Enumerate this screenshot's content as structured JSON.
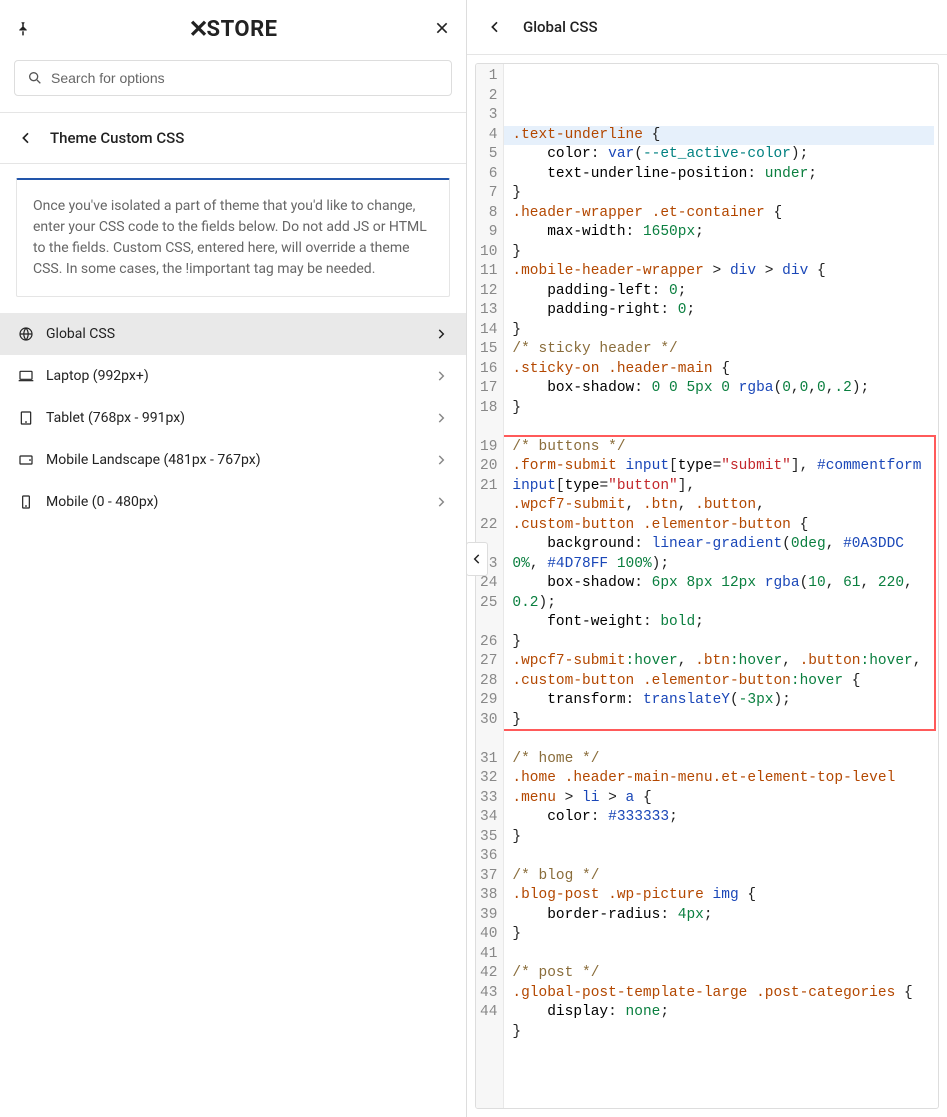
{
  "left": {
    "logo_text": "STORE",
    "search_placeholder": "Search for options",
    "section_title": "Theme Custom CSS",
    "info_text": "Once you've isolated a part of theme that you'd like to change, enter your CSS code to the fields below. Do not add JS or HTML to the fields. Custom CSS, entered here, will override a theme CSS. In some cases, the !important tag may be needed.",
    "menu": [
      {
        "label": "Global CSS",
        "active": true
      },
      {
        "label": "Laptop (992px+)",
        "active": false
      },
      {
        "label": "Tablet (768px - 991px)",
        "active": false
      },
      {
        "label": "Mobile Landscape (481px - 767px)",
        "active": false
      },
      {
        "label": "Mobile (0 - 480px)",
        "active": false
      }
    ]
  },
  "right": {
    "title": "Global CSS",
    "highlight": {
      "start": 17,
      "end": 27
    },
    "total_lines": 44,
    "code": [
      {
        "html": "<span class='c-sel'>.text-underline</span> {"
      },
      {
        "html": "    <span class='c-prop'>color</span>: <span class='c-kw'>var</span>(<span class='c-var'>--et_active-color</span>);"
      },
      {
        "html": "    <span class='c-prop'>text-underline-position</span>: <span class='c-num'>under</span>;"
      },
      {
        "html": "}"
      },
      {
        "html": "<span class='c-sel'>.header-wrapper</span> <span class='c-sel'>.et-container</span> {"
      },
      {
        "html": "    <span class='c-prop'>max-width</span>: <span class='c-num'>1650px</span>;"
      },
      {
        "html": "}"
      },
      {
        "html": "<span class='c-sel'>.mobile-header-wrapper</span> &gt; <span class='c-tag'>div</span> &gt; <span class='c-tag'>div</span> {"
      },
      {
        "html": "    <span class='c-prop'>padding-left</span>: <span class='c-num'>0</span>;"
      },
      {
        "html": "    <span class='c-prop'>padding-right</span>: <span class='c-num'>0</span>;"
      },
      {
        "html": "}"
      },
      {
        "html": "<span class='c-com'>/* sticky header */</span>"
      },
      {
        "html": "<span class='c-sel'>.sticky-on</span> <span class='c-sel'>.header-main</span> {"
      },
      {
        "html": "    <span class='c-prop'>box-shadow</span>: <span class='c-num'>0</span> <span class='c-num'>0</span> <span class='c-num'>5px</span> <span class='c-num'>0</span> <span class='c-kw'>rgba</span>(<span class='c-num'>0</span>,<span class='c-num'>0</span>,<span class='c-num'>0</span>,<span class='c-num'>.2</span>);"
      },
      {
        "html": "}"
      },
      {
        "html": ""
      },
      {
        "html": "<span class='c-com'>/* buttons */</span>"
      },
      {
        "html": "<span class='c-sel'>.form-submit</span> <span class='c-tag'>input</span>[<span class='c-prop'>type</span>=<span class='c-str'>\"submit\"</span>], <span class='c-id'>#commentform</span> <span class='c-tag'>input</span>[<span class='c-prop'>type</span>=<span class='c-str'>\"button\"</span>],"
      },
      {
        "html": "<span class='c-sel'>.wpcf7-submit</span>, <span class='c-sel'>.btn</span>, <span class='c-sel'>.button</span>,"
      },
      {
        "html": "<span class='c-sel'>.custom-button</span> <span class='c-sel'>.elementor-button</span> {"
      },
      {
        "html": "    <span class='c-prop'>background</span>: <span class='c-kw'>linear-gradient</span>(<span class='c-num'>0deg</span>, <span class='c-hex'>#0A3DDC</span> <span class='c-num'>0%</span>, <span class='c-hex'>#4D78FF</span> <span class='c-num'>100%</span>);"
      },
      {
        "html": "    <span class='c-prop'>box-shadow</span>: <span class='c-num'>6px</span> <span class='c-num'>8px</span> <span class='c-num'>12px</span> <span class='c-kw'>rgba</span>(<span class='c-num'>10</span>, <span class='c-num'>61</span>, <span class='c-num'>220</span>, <span class='c-num'>0.2</span>);"
      },
      {
        "html": "    <span class='c-prop'>font-weight</span>: <span class='c-num'>bold</span>;"
      },
      {
        "html": "}"
      },
      {
        "html": "<span class='c-sel'>.wpcf7-submit</span><span class='c-pseu'>:hover</span>, <span class='c-sel'>.btn</span><span class='c-pseu'>:hover</span>, <span class='c-sel'>.button</span><span class='c-pseu'>:hover</span>, <span class='c-sel'>.custom-button</span> <span class='c-sel'>.elementor-button</span><span class='c-pseu'>:hover</span> {"
      },
      {
        "html": "    <span class='c-prop'>transform</span>: <span class='c-kw'>translateY</span>(<span class='c-num'>-3px</span>);"
      },
      {
        "html": "}"
      },
      {
        "html": ""
      },
      {
        "html": "<span class='c-com'>/* home */</span>"
      },
      {
        "html": "<span class='c-sel'>.home</span> <span class='c-sel'>.header-main-menu.et-element-top-level</span> <span class='c-sel'>.menu</span> &gt; <span class='c-tag'>li</span> &gt; <span class='c-tag'>a</span> {"
      },
      {
        "html": "    <span class='c-prop'>color</span>: <span class='c-hex'>#333333</span>;"
      },
      {
        "html": "}"
      },
      {
        "html": ""
      },
      {
        "html": "<span class='c-com'>/* blog */</span>"
      },
      {
        "html": "<span class='c-sel'>.blog-post</span> <span class='c-sel'>.wp-picture</span> <span class='c-tag'>img</span> {"
      },
      {
        "html": "    <span class='c-prop'>border-radius</span>: <span class='c-num'>4px</span>;"
      },
      {
        "html": "}"
      },
      {
        "html": ""
      },
      {
        "html": "<span class='c-com'>/* post */</span>"
      },
      {
        "html": "<span class='c-sel'>.global-post-template-large</span> <span class='c-sel'>.post-categories</span> {"
      },
      {
        "html": "    <span class='c-prop'>display</span>: <span class='c-num'>none</span>;"
      },
      {
        "html": "}"
      },
      {
        "html": ""
      },
      {
        "html": ""
      }
    ]
  }
}
